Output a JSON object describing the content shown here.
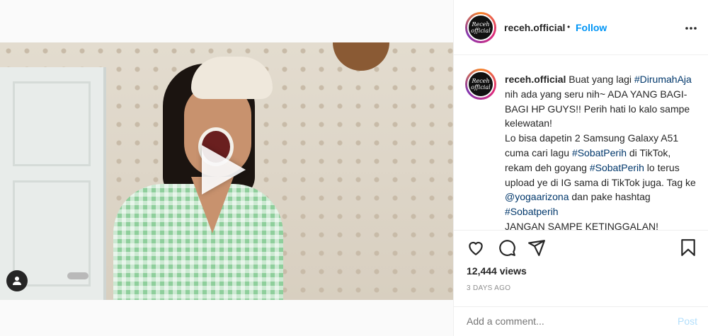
{
  "header": {
    "username": "receh.official",
    "separator": "•",
    "follow_label": "Follow",
    "more_icon": "more-options-icon",
    "avatar_text": "Receh official"
  },
  "caption": {
    "username": "receh.official",
    "segments": [
      {
        "type": "text",
        "value": " Buat yang lagi "
      },
      {
        "type": "hashtag",
        "value": "#DirumahAja"
      },
      {
        "type": "text",
        "value": " nih ada yang seru nih~ ADA YANG BAGI-BAGI HP GUYS!! Perih hati lo kalo sampe kelewatan!"
      },
      {
        "type": "br"
      },
      {
        "type": "text",
        "value": "Lo bisa dapetin 2 Samsung Galaxy A51 cuma cari lagu "
      },
      {
        "type": "hashtag",
        "value": "#SobatPerih"
      },
      {
        "type": "text",
        "value": " di TikTok, rekam deh goyang "
      },
      {
        "type": "hashtag",
        "value": "#SobatPerih"
      },
      {
        "type": "text",
        "value": " lo terus upload ye di IG sama di TikTok juga. Tag ke "
      },
      {
        "type": "hashtag",
        "value": "@yogaarizona"
      },
      {
        "type": "text",
        "value": " dan pake hashtag "
      },
      {
        "type": "hashtag",
        "value": "#Sobatperih"
      },
      {
        "type": "br"
      },
      {
        "type": "text",
        "value": "JANGAN SAMPE KETINGGALAN!"
      }
    ]
  },
  "actions": {
    "like_icon": "heart-icon",
    "comment_icon": "comment-icon",
    "share_icon": "share-icon",
    "save_icon": "bookmark-icon"
  },
  "stats": {
    "views": "12,444 views",
    "time": "3 DAYS AGO"
  },
  "comment_box": {
    "placeholder": "Add a comment...",
    "post_label": "Post"
  },
  "colors": {
    "link": "#0095f6",
    "hashtag": "#00376b",
    "muted": "#8e8e8e"
  }
}
